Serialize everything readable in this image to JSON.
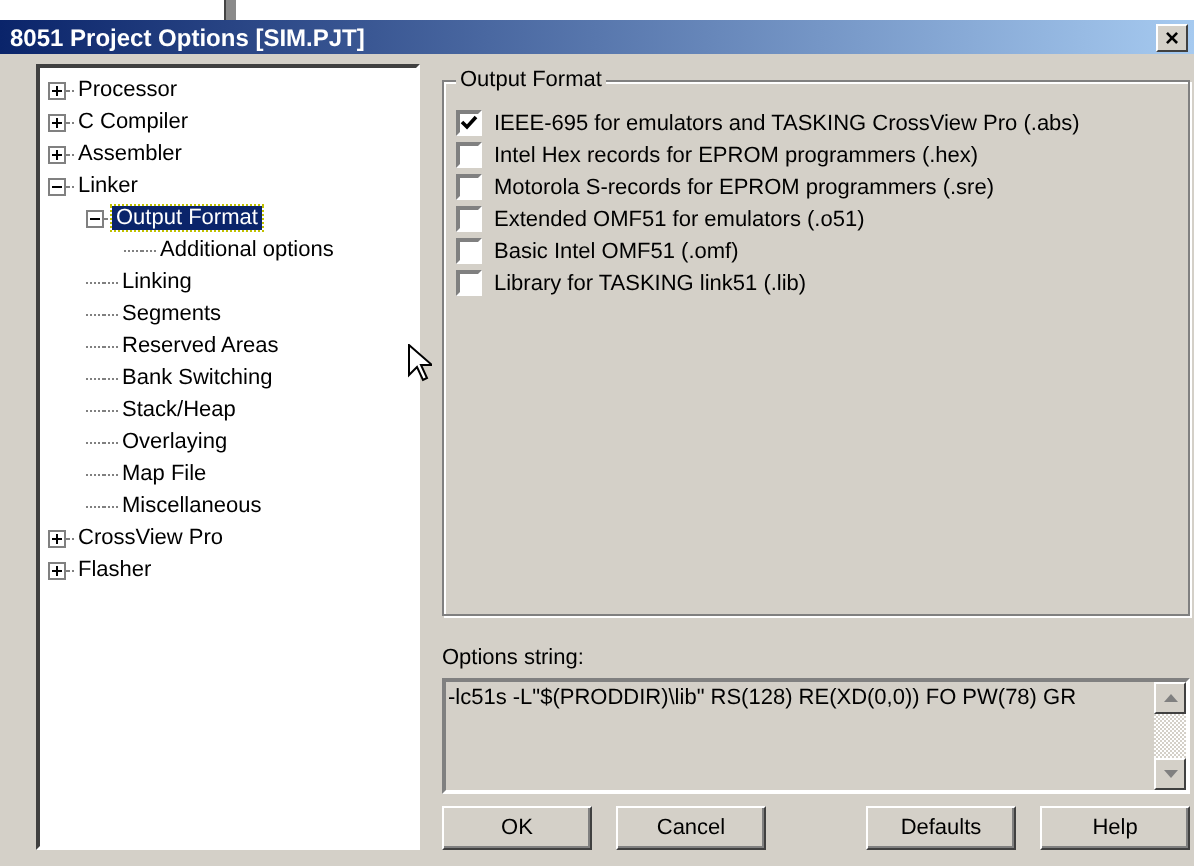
{
  "window": {
    "title": "8051 Project Options [SIM.PJT]",
    "close": "×"
  },
  "tree": [
    {
      "label": "Processor",
      "expanded": false,
      "selected": false
    },
    {
      "label": "C Compiler",
      "expanded": false,
      "selected": false
    },
    {
      "label": "Assembler",
      "expanded": false,
      "selected": false
    },
    {
      "label": "Linker",
      "expanded": true,
      "selected": false,
      "children": [
        {
          "label": "Output Format",
          "expanded": true,
          "selected": true,
          "children": [
            {
              "label": "Additional options",
              "selected": false
            }
          ]
        },
        {
          "label": "Linking",
          "selected": false
        },
        {
          "label": "Segments",
          "selected": false
        },
        {
          "label": "Reserved Areas",
          "selected": false
        },
        {
          "label": "Bank Switching",
          "selected": false
        },
        {
          "label": "Stack/Heap",
          "selected": false
        },
        {
          "label": "Overlaying",
          "selected": false
        },
        {
          "label": "Map File",
          "selected": false
        },
        {
          "label": "Miscellaneous",
          "selected": false
        }
      ]
    },
    {
      "label": "CrossView Pro",
      "expanded": false,
      "selected": false
    },
    {
      "label": "Flasher",
      "expanded": false,
      "selected": false
    }
  ],
  "output_format": {
    "title": "Output Format",
    "options": [
      {
        "label": "IEEE-695 for emulators and TASKING CrossView Pro (.abs)",
        "checked": true
      },
      {
        "label": "Intel Hex records for EPROM programmers (.hex)",
        "checked": false
      },
      {
        "label": "Motorola S-records for EPROM programmers (.sre)",
        "checked": false
      },
      {
        "label": "Extended OMF51 for emulators (.o51)",
        "checked": false
      },
      {
        "label": "Basic Intel OMF51 (.omf)",
        "checked": false
      },
      {
        "label": "Library for TASKING link51 (.lib)",
        "checked": false
      }
    ]
  },
  "options_string": {
    "label": "Options string:",
    "value": "-lc51s -L\"$(PRODDIR)\\lib\" RS(128) RE(XD(0,0)) FO PW(78) GR"
  },
  "buttons": [
    "OK",
    "Cancel",
    "Defaults",
    "Help"
  ]
}
